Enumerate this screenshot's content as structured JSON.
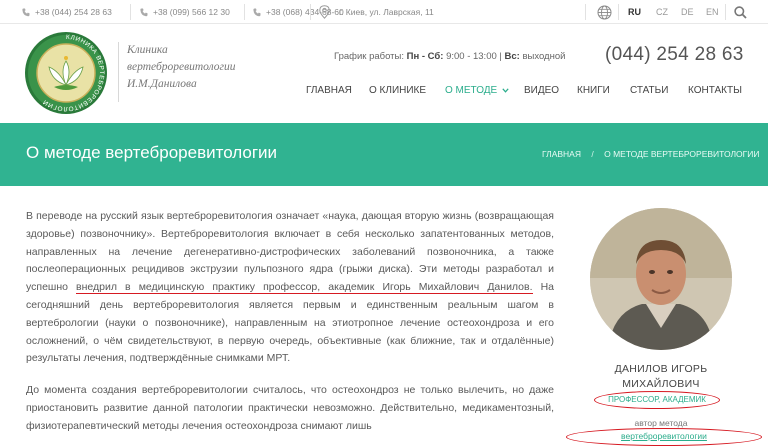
{
  "topbar": {
    "phones": [
      "+38 (044) 254 28 63",
      "+38 (099) 566 12 30",
      "+38 (068) 434-68-60"
    ],
    "address": "г. Киев, ул. Лаврская, 11",
    "languages": [
      {
        "code": "RU",
        "active": true
      },
      {
        "code": "CZ",
        "active": false
      },
      {
        "code": "DE",
        "active": false
      },
      {
        "code": "EN",
        "active": false
      }
    ]
  },
  "header": {
    "logo_text": "КЛИНИКА ВЕРТЕБРОРЕВИТОЛОГИИ",
    "brand_lines": [
      "Клиника",
      "вертеброревитологии",
      "И.М.Данилова"
    ],
    "hours_label": "График работы:",
    "hours_days": "Пн - Сб:",
    "hours_time": "9:00 - 13:00 |",
    "hours_sunday": "Вс:",
    "hours_off": "выходной",
    "phone": "(044) 254 28 63"
  },
  "nav": {
    "items": [
      {
        "label": "ГЛАВНАЯ"
      },
      {
        "label": "О КЛИНИКЕ"
      },
      {
        "label": "О МЕТОДЕ"
      },
      {
        "label": "ВИДЕО"
      },
      {
        "label": "КНИГИ"
      },
      {
        "label": "СТАТЬИ"
      },
      {
        "label": "КОНТАКТЫ"
      }
    ]
  },
  "banner": {
    "title": "О методе вертеброревитологии",
    "breadcrumb_home": "ГЛАВНАЯ",
    "breadcrumb_sep": "/",
    "breadcrumb_current": "О МЕТОДЕ ВЕРТЕБРОРЕВИТОЛОГИИ"
  },
  "article": {
    "p1_a": "В переводе на русский язык вертеброревитология означает «наука, дающая вторую жизнь (возвращающая здоровье) позвоночнику». Вертеброревитология включает в себя несколько запатентованных методов, направленных на лечение дегенеративно-дистрофических заболеваний позвоночника, а также послеоперационных рецидивов экструзии пульпозного ядра (грыжи диска). Эти методы разработал и успешно ",
    "p1_mark": "внедрил в медицинскую практику профессор, академик Игорь Михайлович Данилов.",
    "p1_b": " На сегодняшний день вертеброревитология является первым и единственным реальным шагом в вертебрологии (науки о позвоночнике), направленным на этиотропное лечение остеохондроза и его осложнений, о чём свидетельствуют, в первую очередь, объективные (как ближние, так и отдалённые) результаты лечения, подтверждённые снимками МРТ.",
    "p2": "До момента создания вертеброревитологии считалось, что остеохондроз не только вылечить, но даже приостановить развитие данной патологии практически невозможно. Действительно, медикаментозный, физиотерапевтический методы лечения остеохондроза снимают лишь"
  },
  "sidebar": {
    "name_line1": "ДАНИЛОВ ИГОРЬ",
    "name_line2": "МИХАЙЛОВИЧ",
    "title": "ПРОФЕССОР, АКАДЕМИК",
    "author_label": "автор метода",
    "method_link": "вертеброревитологии"
  },
  "colors": {
    "accent": "#30b391",
    "highlight": "#d61a22"
  }
}
